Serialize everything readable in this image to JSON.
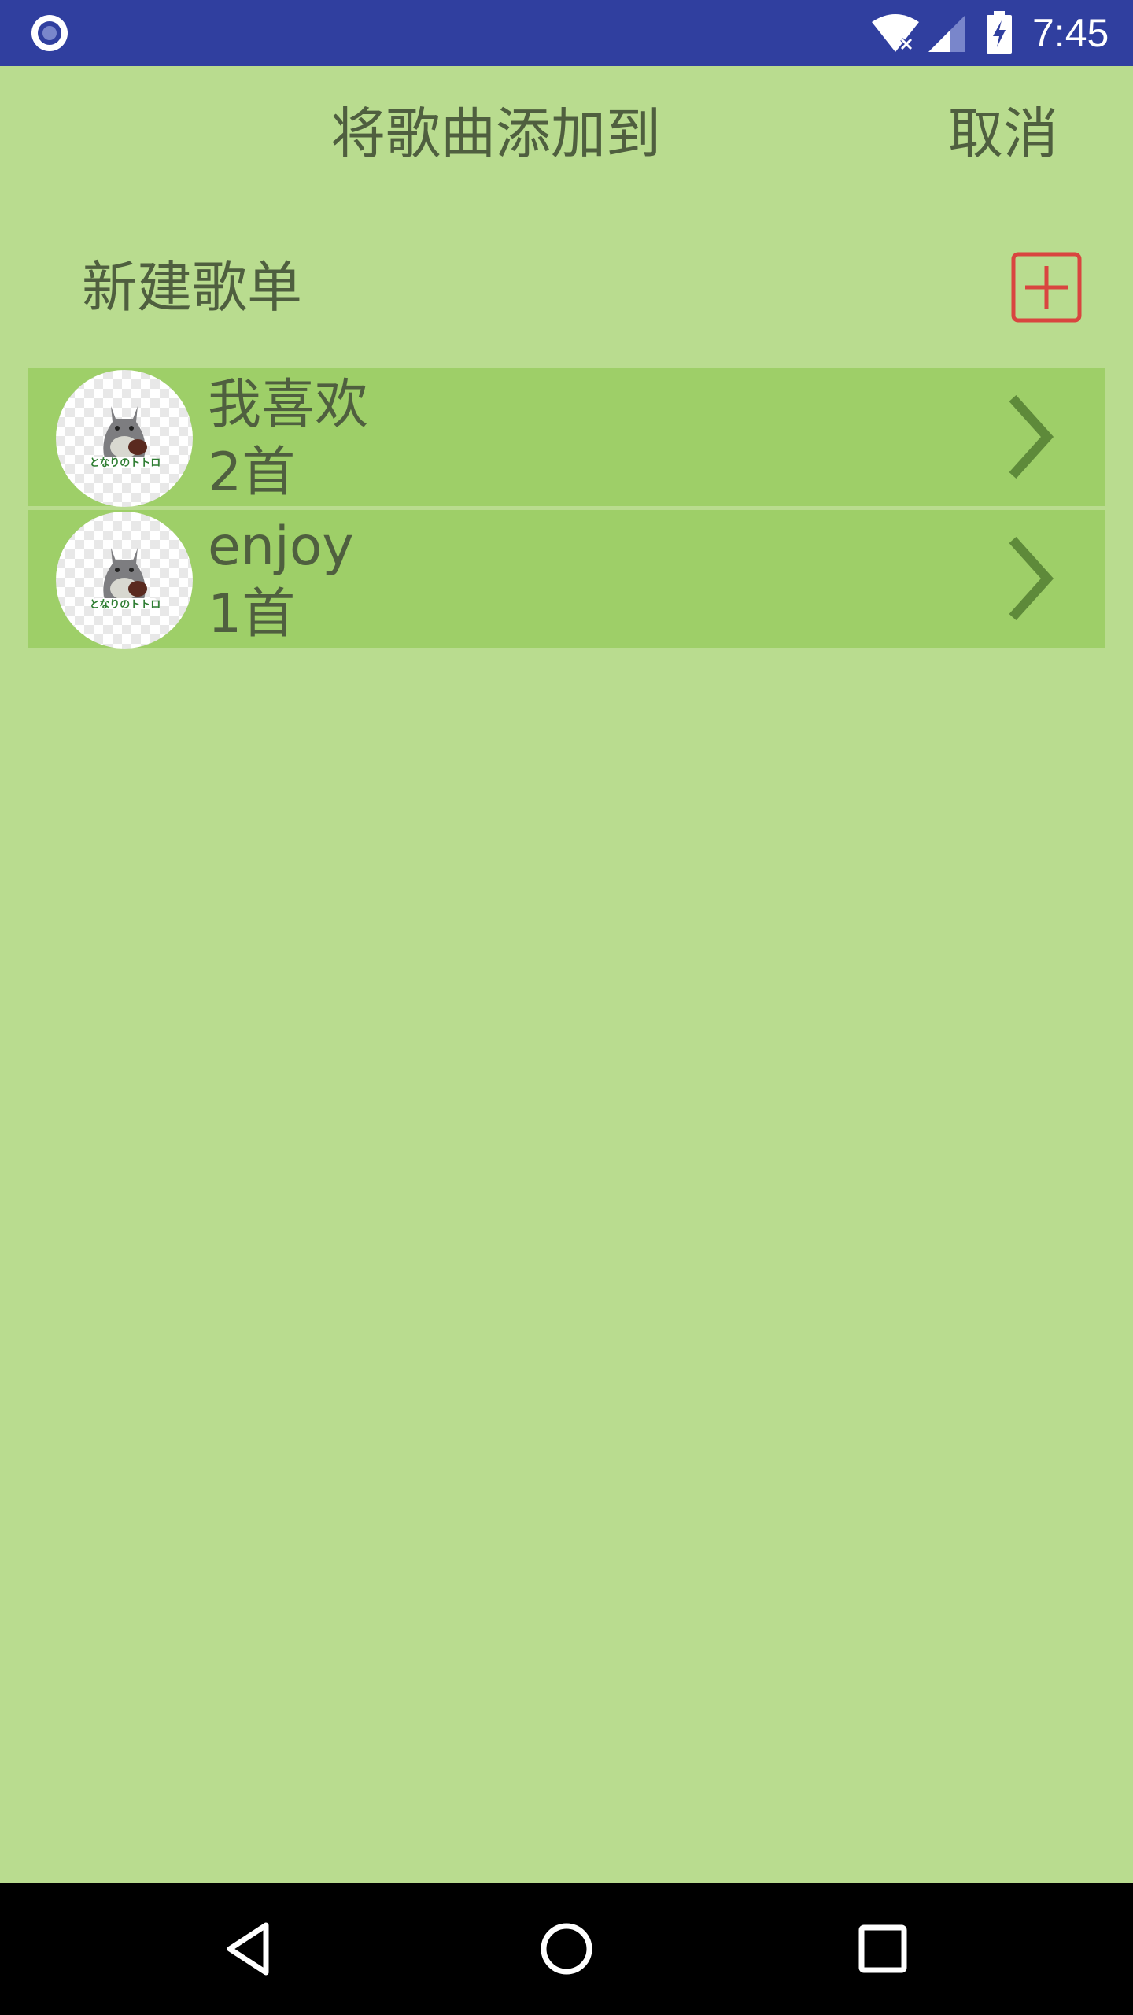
{
  "status_bar": {
    "time": "7:45",
    "icons": [
      "app-notification-icon",
      "wifi-icon",
      "cell-signal-icon",
      "battery-charging-icon"
    ]
  },
  "header": {
    "title": "将歌曲添加到",
    "cancel_label": "取消"
  },
  "new_playlist": {
    "label": "新建歌单",
    "icon": "add-square-icon",
    "icon_color": "#d9453f"
  },
  "playlists": [
    {
      "name": "我喜欢",
      "count": "2首",
      "cover_icon": "totoro-cover"
    },
    {
      "name": "enjoy",
      "count": "1首",
      "cover_icon": "totoro-cover"
    }
  ],
  "nav_bar": {
    "buttons": [
      "back-icon",
      "home-icon",
      "recents-icon"
    ]
  },
  "colors": {
    "status_bar": "#303f9f",
    "background": "#b9dc8f",
    "list_item": "#9ecf68",
    "text": "#4f5f3f",
    "accent": "#d9453f"
  }
}
